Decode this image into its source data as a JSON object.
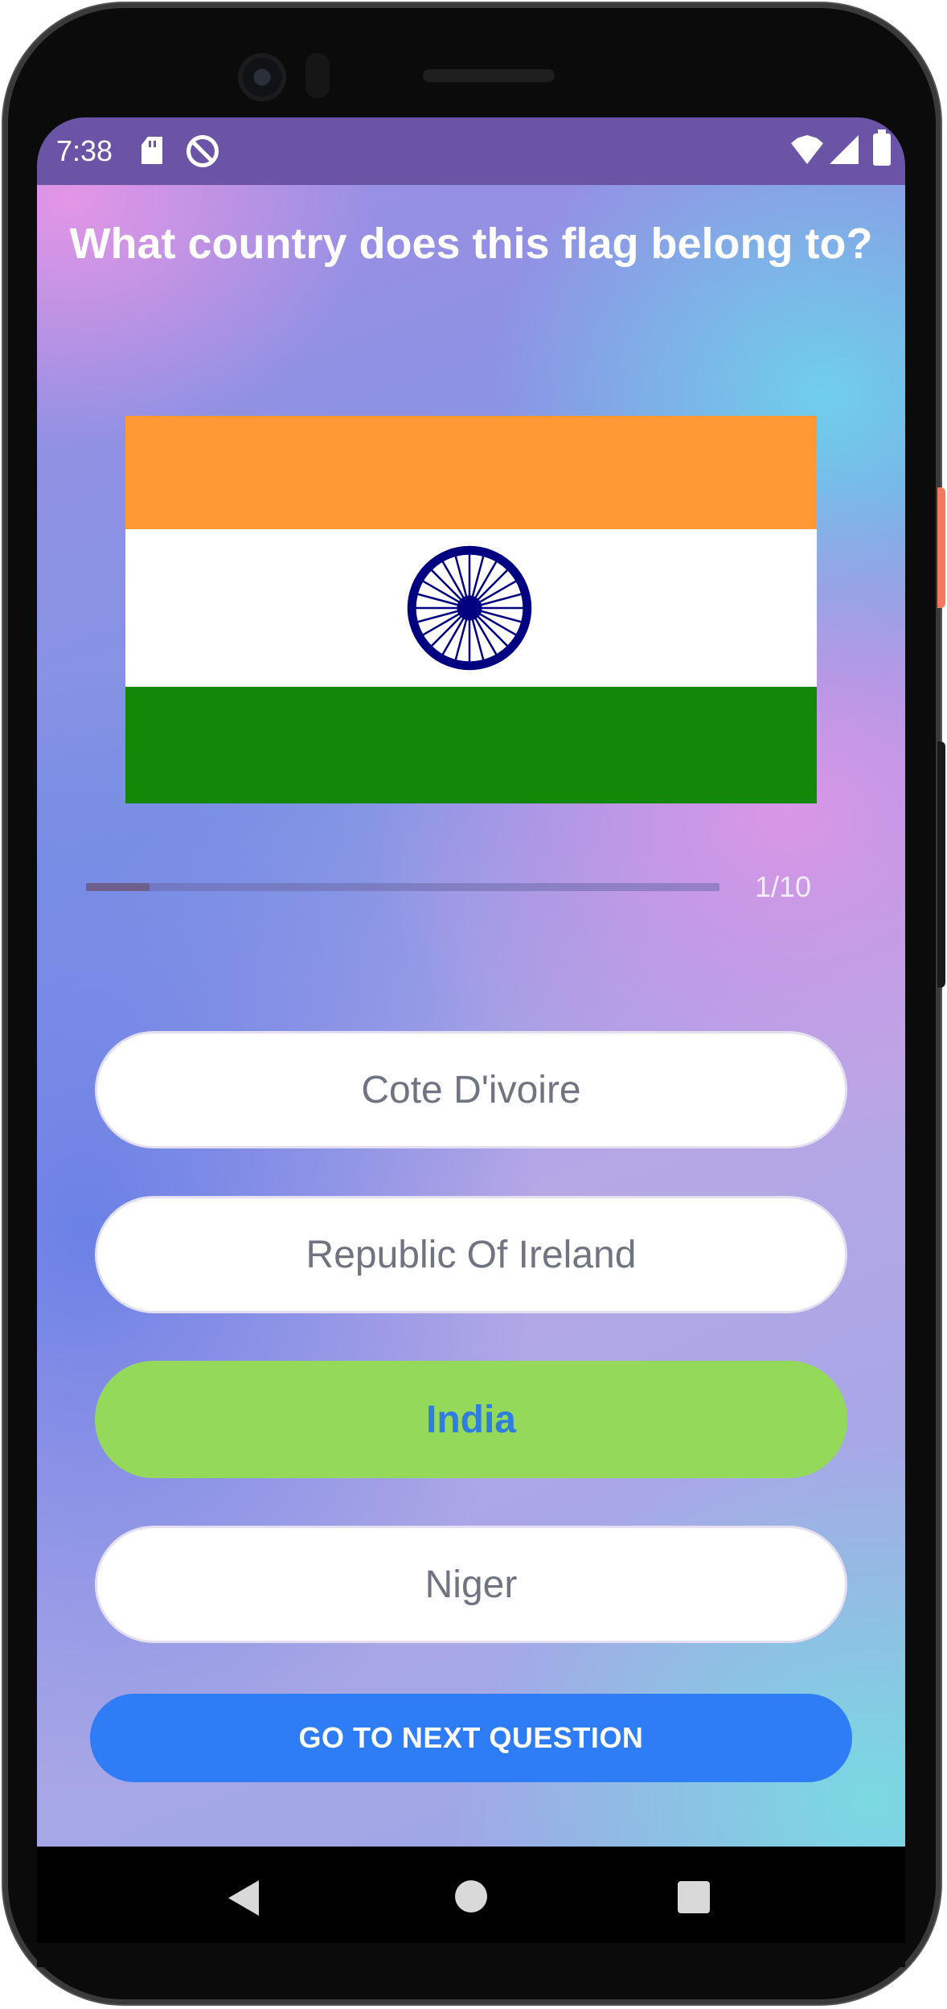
{
  "status_bar": {
    "time": "7:38",
    "icons": [
      "sd-card-icon",
      "sync-disabled-icon",
      "wifi-icon",
      "signal-icon",
      "battery-icon"
    ]
  },
  "quiz": {
    "question": "What country does this flag belong to?",
    "flag_icon": "india-flag",
    "progress": {
      "current": 1,
      "total": 10,
      "fraction": 0.1,
      "text": "1/10"
    },
    "options": [
      {
        "label": "Cote D'ivoire",
        "selected": false
      },
      {
        "label": "Republic Of Ireland",
        "selected": false
      },
      {
        "label": "India",
        "selected": true
      },
      {
        "label": "Niger",
        "selected": false
      }
    ],
    "next_button": "GO TO NEXT QUESTION"
  },
  "colors": {
    "selected_option_bg": "#94d95a",
    "selected_option_text": "#2f7de0",
    "next_button_bg": "#2f7cf7",
    "status_bar_bg": "#6b54a6",
    "flag_saffron": "#ff9933",
    "flag_white": "#ffffff",
    "flag_green": "#138808",
    "flag_chakra": "#000080"
  },
  "nav_bar": {
    "icons": [
      "back-icon",
      "home-icon",
      "recents-icon"
    ]
  }
}
